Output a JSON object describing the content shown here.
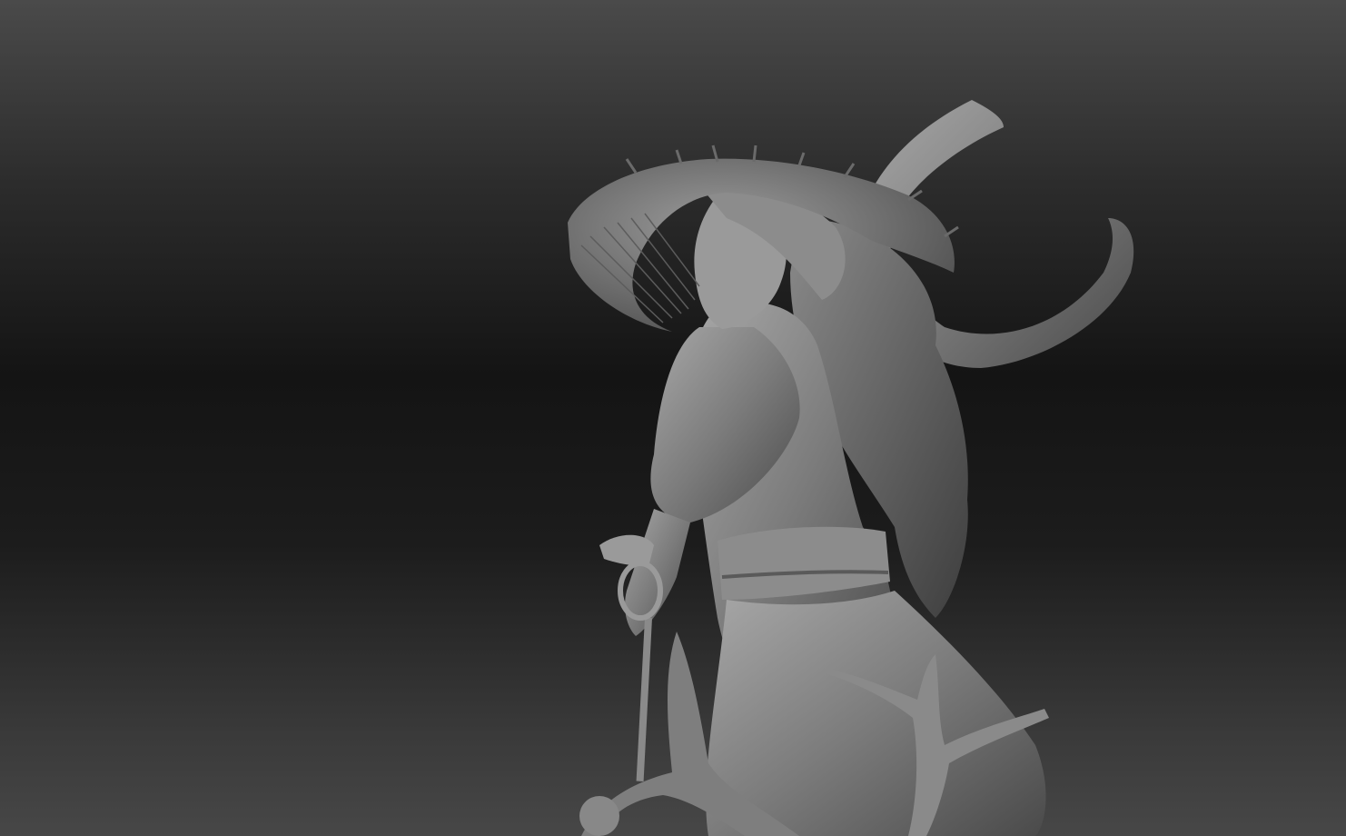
{
  "scene": {
    "subject": "",
    "background_top": "#4a4a4a",
    "background_mid": "#141414",
    "background_bottom": "#474747",
    "clay_color": "#8a8a8a"
  }
}
